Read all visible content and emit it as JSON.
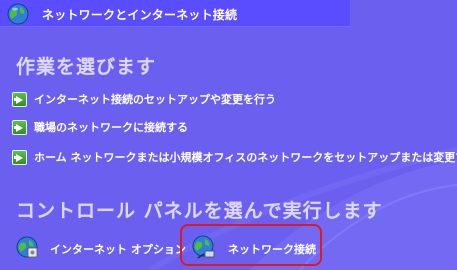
{
  "window": {
    "title": "ネットワークとインターネット接続"
  },
  "tasks_section": {
    "heading": "作業を選びます",
    "items": [
      {
        "label": "インターネット接続のセットアップや変更を行う"
      },
      {
        "label": "職場のネットワークに接続する"
      },
      {
        "label": "ホーム ネットワークまたは小規模オフィスのネットワークをセットアップまたは変更する"
      }
    ]
  },
  "control_panel_section": {
    "heading": "コントロール パネルを選んで実行します",
    "items": [
      {
        "label": "インターネット オプション",
        "icon": "internet-options-icon"
      },
      {
        "label": "ネットワーク接続",
        "icon": "network-connections-icon",
        "highlighted": true
      }
    ]
  },
  "colors": {
    "background": "#6b5ff0",
    "titlebar": "#5a4dff",
    "heading": "#dcd8ff",
    "highlight_border": "#e0191e",
    "task_arrow": "#3fa62a"
  }
}
